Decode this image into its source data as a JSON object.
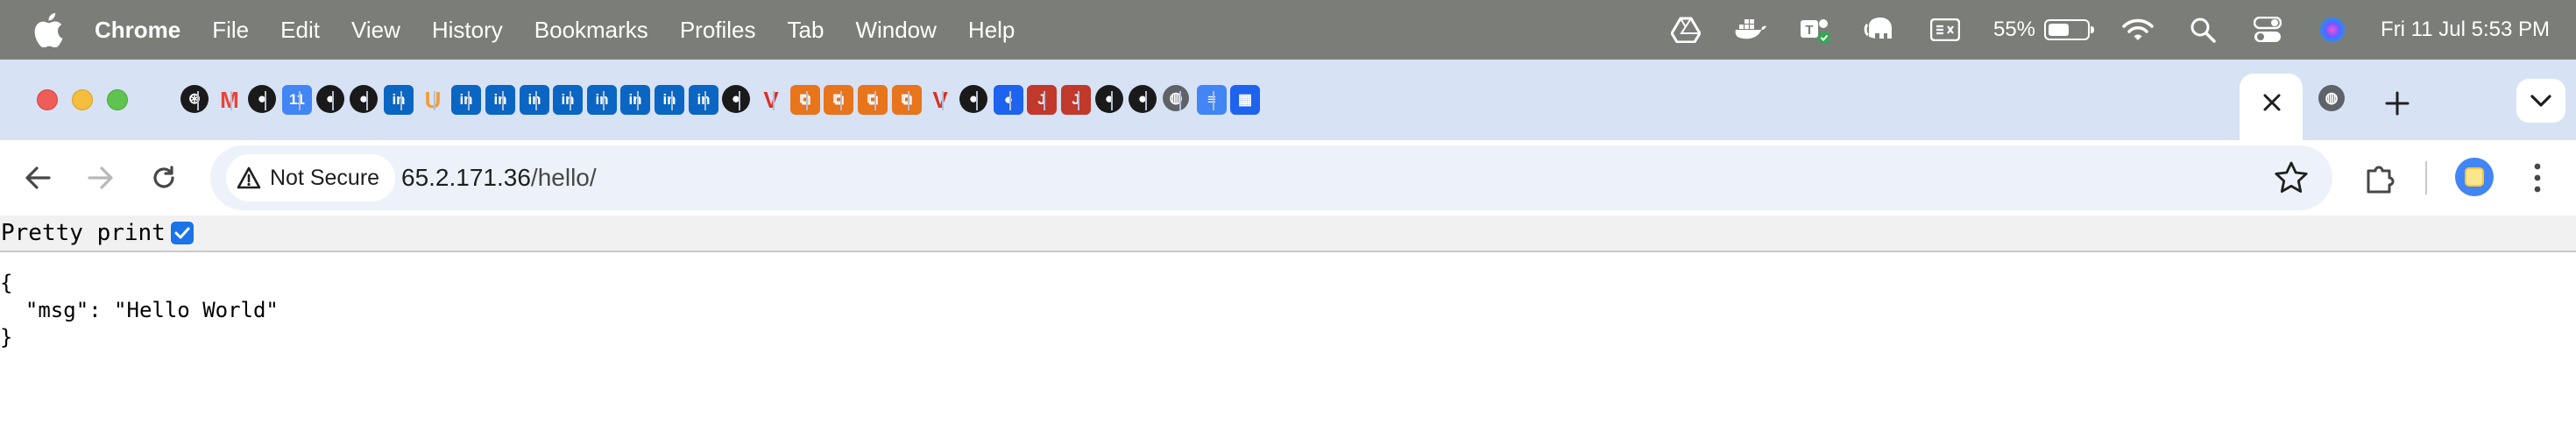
{
  "menubar": {
    "apple_icon": "apple-logo-icon",
    "app_name": "Chrome",
    "items": [
      "File",
      "Edit",
      "View",
      "History",
      "Bookmarks",
      "Profiles",
      "Tab",
      "Window",
      "Help"
    ],
    "status_icons": [
      "google-drive-icon",
      "docker-icon",
      "teams-icon",
      "elephant-icon",
      "input-source-icon"
    ],
    "battery_percent": "55%",
    "battery_level": 0.55,
    "status_icons_right": [
      "wifi-icon",
      "spotlight-search-icon",
      "control-center-icon",
      "siri-icon"
    ],
    "datetime": "Fri 11 Jul  5:53 PM"
  },
  "tabs": {
    "favicons": [
      {
        "icon": "openai-icon",
        "color": "#1a1a1a",
        "glyph": "⊛"
      },
      {
        "icon": "gmail-icon",
        "color": "#ea4335",
        "glyph": "M"
      },
      {
        "icon": "github-icon",
        "color": "#1a1a1a",
        "glyph": "●"
      },
      {
        "icon": "google-calendar-icon",
        "color": "#4285f4",
        "glyph": "11"
      },
      {
        "icon": "github-icon",
        "color": "#1a1a1a",
        "glyph": "●"
      },
      {
        "icon": "github-icon",
        "color": "#1a1a1a",
        "glyph": "●"
      },
      {
        "icon": "linkedin-icon",
        "color": "#0a66c2",
        "glyph": "in"
      },
      {
        "icon": "unsplash-icon",
        "color": "#f29d38",
        "glyph": "U"
      },
      {
        "icon": "linkedin-icon",
        "color": "#0a66c2",
        "glyph": "in"
      },
      {
        "icon": "linkedin-icon",
        "color": "#0a66c2",
        "glyph": "in"
      },
      {
        "icon": "linkedin-icon",
        "color": "#0a66c2",
        "glyph": "in"
      },
      {
        "icon": "linkedin-icon",
        "color": "#0a66c2",
        "glyph": "in"
      },
      {
        "icon": "linkedin-icon",
        "color": "#0a66c2",
        "glyph": "in"
      },
      {
        "icon": "linkedin-icon",
        "color": "#0a66c2",
        "glyph": "in"
      },
      {
        "icon": "linkedin-icon",
        "color": "#0a66c2",
        "glyph": "in"
      },
      {
        "icon": "linkedin-icon",
        "color": "#0a66c2",
        "glyph": "in"
      },
      {
        "icon": "github-icon",
        "color": "#1a1a1a",
        "glyph": "●"
      },
      {
        "icon": "vercel-icon",
        "color": "#d93025",
        "glyph": "V"
      },
      {
        "icon": "aws-console-icon",
        "color": "#e8741c",
        "glyph": "⧉"
      },
      {
        "icon": "aws-console-icon",
        "color": "#e8741c",
        "glyph": "⧉"
      },
      {
        "icon": "aws-console-icon",
        "color": "#e8741c",
        "glyph": "⧉"
      },
      {
        "icon": "aws-console-icon",
        "color": "#e8741c",
        "glyph": "⧉"
      },
      {
        "icon": "vultr-icon",
        "color": "#d93025",
        "glyph": "V"
      },
      {
        "icon": "github-icon",
        "color": "#1a1a1a",
        "glyph": "●"
      },
      {
        "icon": "docker-hub-icon",
        "color": "#1d63ed",
        "glyph": "●"
      },
      {
        "icon": "jenkins-icon",
        "color": "#c0392b",
        "glyph": "J"
      },
      {
        "icon": "jenkins-icon",
        "color": "#c0392b",
        "glyph": "J"
      },
      {
        "icon": "github-icon",
        "color": "#1a1a1a",
        "glyph": "●"
      },
      {
        "icon": "github-icon",
        "color": "#1a1a1a",
        "glyph": "●"
      },
      {
        "icon": "globe-icon",
        "color": "#5f6368",
        "glyph": "◍"
      },
      {
        "icon": "google-docs-icon",
        "color": "#4285f4",
        "glyph": "≡"
      },
      {
        "icon": "docker-icon",
        "color": "#1d63ed",
        "glyph": "▦"
      }
    ],
    "active_tab_close_icon": "close-icon",
    "after_active": [
      {
        "icon": "globe-icon",
        "color": "#5f6368",
        "glyph": "◍"
      }
    ],
    "new_tab_icon": "plus-icon",
    "tab_search_icon": "chevron-down-icon"
  },
  "toolbar": {
    "back_icon": "back-arrow-icon",
    "forward_icon": "forward-arrow-icon",
    "reload_icon": "reload-icon",
    "security_label": "Not Secure",
    "security_icon": "warning-triangle-icon",
    "url_host": "65.2.171.36",
    "url_path": "/hello/",
    "bookmark_icon": "star-icon",
    "extensions_icon": "puzzle-piece-icon",
    "profile_icon": "profile-avatar-icon",
    "menu_icon": "kebab-menu-icon"
  },
  "page": {
    "pretty_print_label": "Pretty print",
    "pretty_print_checked": true,
    "json_text": "{\n  \"msg\": \"Hello World\"\n}"
  },
  "colors": {
    "menubar_bg": "#7b7d79",
    "tabstrip_bg": "#d7e2f5",
    "omnibox_bg": "#edf2fa",
    "checkbox_accent": "#1a73e8"
  }
}
